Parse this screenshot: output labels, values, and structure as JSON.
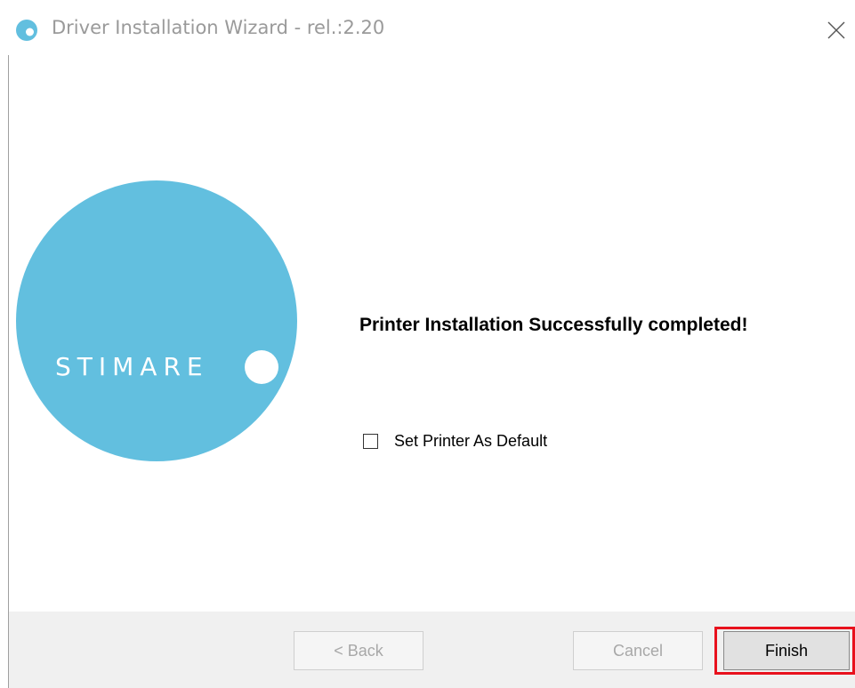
{
  "window": {
    "title": "Driver Installation Wizard - rel.:2.20",
    "close_icon": "close-icon",
    "app_icon": "app-circle-icon"
  },
  "logo": {
    "text": "STIMARE",
    "color": "#62bfdf"
  },
  "main": {
    "message": "Printer Installation Successfully completed!",
    "checkbox_label": "Set Printer As Default",
    "checkbox_checked": false
  },
  "buttons": {
    "back_label": "< Back",
    "cancel_label": "Cancel",
    "finish_label": "Finish",
    "highlight_color": "#e8111d"
  }
}
